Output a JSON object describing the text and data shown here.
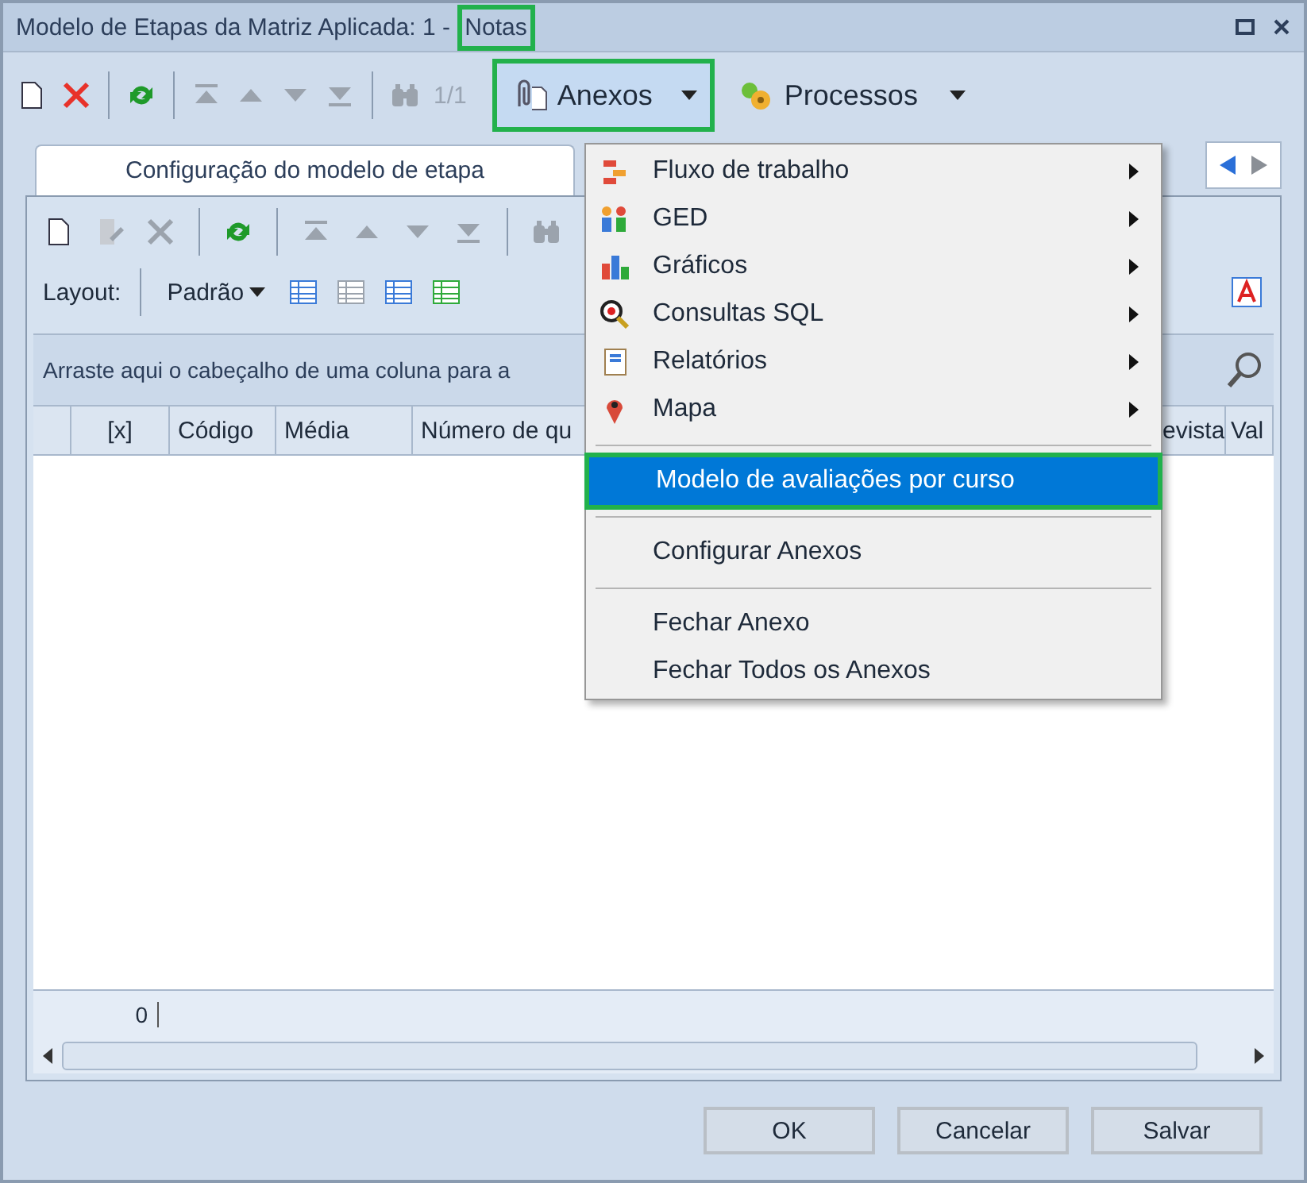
{
  "window": {
    "title_prefix": "Modelo de Etapas da Matriz Aplicada: 1 - ",
    "title_highlight": {
      "text": "Notas",
      "highlighted": true
    }
  },
  "toolbar": {
    "pager": "1/1",
    "anexos": {
      "label": "Anexos",
      "highlighted": true
    },
    "processos": {
      "label": "Processos"
    }
  },
  "tabs": [
    {
      "label": "Configuração do modelo de etapa",
      "selected": true
    }
  ],
  "layout_bar": {
    "label": "Layout:",
    "value": "Padrão"
  },
  "group_panel": {
    "hint": "Arraste aqui o cabeçalho de uma coluna para a"
  },
  "table": {
    "columns": [
      "[x]",
      "Código",
      "Média",
      "Número de qu"
    ],
    "right_columns": [
      "evista",
      "Val"
    ],
    "footer_count": "0"
  },
  "menu": {
    "items": [
      {
        "kind": "submenu",
        "label": "Fluxo de trabalho",
        "selected": false
      },
      {
        "kind": "submenu",
        "label": "GED",
        "selected": false
      },
      {
        "kind": "submenu",
        "label": "Gráficos",
        "selected": false
      },
      {
        "kind": "submenu",
        "label": "Consultas SQL",
        "selected": false
      },
      {
        "kind": "submenu",
        "label": "Relatórios",
        "selected": false
      },
      {
        "kind": "submenu",
        "label": "Mapa",
        "selected": false
      },
      {
        "kind": "separator"
      },
      {
        "kind": "item",
        "label": "Modelo de avaliações por curso",
        "selected": true,
        "highlighted": true
      },
      {
        "kind": "separator"
      },
      {
        "kind": "item",
        "label": "Configurar Anexos",
        "selected": false
      },
      {
        "kind": "separator"
      },
      {
        "kind": "item",
        "label": "Fechar Anexo",
        "selected": false
      },
      {
        "kind": "item",
        "label": "Fechar Todos os Anexos",
        "selected": false
      }
    ]
  },
  "buttons": [
    {
      "label": "OK"
    },
    {
      "label": "Cancelar"
    },
    {
      "label": "Salvar"
    }
  ]
}
